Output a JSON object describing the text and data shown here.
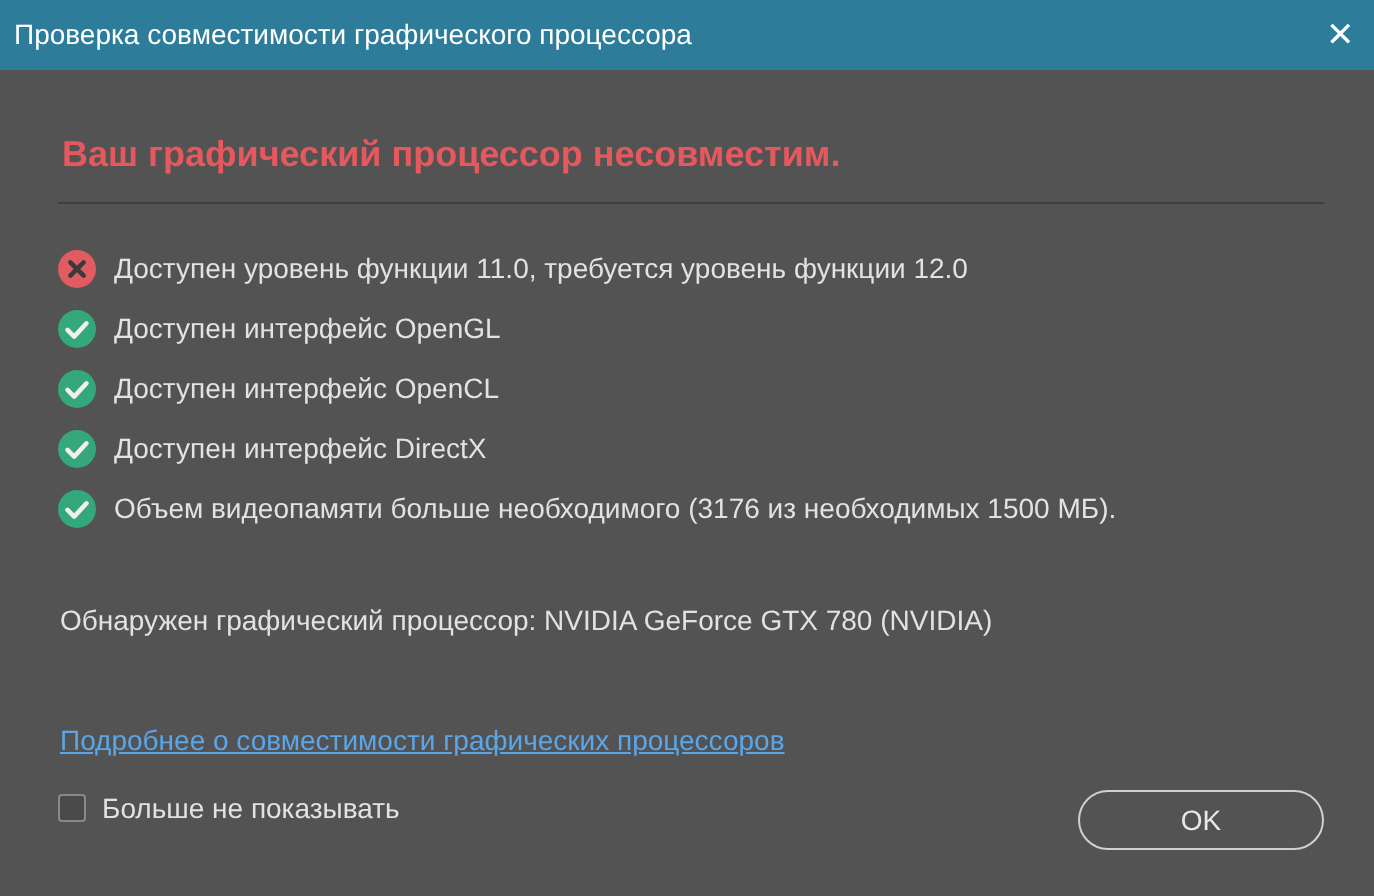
{
  "window": {
    "title": "Проверка совместимости графического процессора",
    "close": "✕"
  },
  "heading": "Ваш графический процессор несовместим.",
  "checks": [
    {
      "text": "Доступен уровень функции 11.0, требуется уровень функции 12.0",
      "passed": false
    },
    {
      "text": "Доступен интерфейс OpenGL",
      "passed": true
    },
    {
      "text": "Доступен интерфейс OpenCL",
      "passed": true
    },
    {
      "text": "Доступен интерфейс DirectX",
      "passed": true
    },
    {
      "text": "Объем видеопамяти больше необходимого (3176 из необходимых 1500 МБ).",
      "passed": true
    }
  ],
  "detected": "Обнаружен графический процессор: NVIDIA GeForce GTX 780 (NVIDIA)",
  "link": "Подробнее о совместимости графических процессоров",
  "dont_show": {
    "label": "Больше не показывать",
    "checked": false
  },
  "ok_button": "OK"
}
